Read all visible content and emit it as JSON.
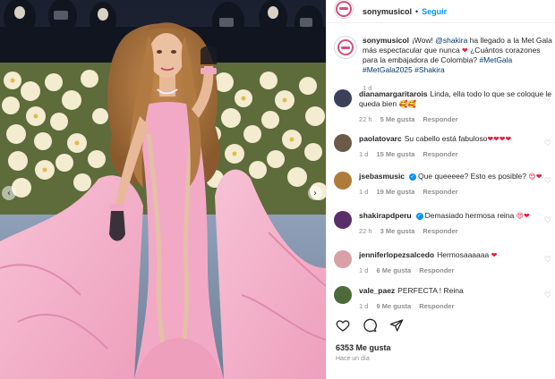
{
  "post": {
    "author": "sonymusicol",
    "follow_label": "Seguir",
    "caption": {
      "author": "sonymusicol",
      "text_before": "¡Wow! ",
      "mention": "@shakira",
      "text_line": " ha llegado a la Met Gala más espectacular que nunca ",
      "text_after": " ¿Cuántos corazones para la embajadora de Colombia? ",
      "hashtags": "#MetGala #MetGala2025 #Shakira",
      "time": "1 d"
    },
    "likes": "6353 Me gusta",
    "posted": "Hace un día"
  },
  "comments": [
    {
      "user": "dianamargaritarois",
      "text": "Linda, ella todo lo que se coloque le queda bien ",
      "emoji": "🥰🥰",
      "time": "22 h",
      "likes": "5 Me gusta",
      "reply": "Responder",
      "avatar_color": "#3a3f5a"
    },
    {
      "user": "paolatovarc",
      "text": "Su cabello está fabuloso",
      "emoji": "❤❤❤❤",
      "time": "1 d",
      "likes": "15 Me gusta",
      "reply": "Responder",
      "avatar_color": "#6b5a48"
    },
    {
      "user": "jsebasmusic",
      "text": "Que queeeee? Esto es posible? ",
      "emoji": "😍❤",
      "time": "1 d",
      "likes": "19 Me gusta",
      "reply": "Responder",
      "avatar_color": "#b07a3a"
    },
    {
      "user": "shakirapdperu",
      "text": "Demasiado hermosa reina ",
      "emoji": "😍❤",
      "time": "22 h",
      "likes": "3 Me gusta",
      "reply": "Responder",
      "avatar_color": "#5a2e6b"
    },
    {
      "user": "jenniferlopezsalcedo",
      "text": "Hermosaaaaaa ",
      "emoji": "❤",
      "time": "1 d",
      "likes": "6 Me gusta",
      "reply": "Responder",
      "avatar_color": "#d9a0a8"
    },
    {
      "user": "vale_paez",
      "text": "PERFECTA ! Reina",
      "emoji": "",
      "time": "1 d",
      "likes": "9 Me gusta",
      "reply": "Responder",
      "avatar_color": "#4c6a3a"
    }
  ],
  "colors": {
    "accent": "#0095f6",
    "heart": "#ed1c3b",
    "muted": "#8e8e8e",
    "dress": "#f2a9c6"
  },
  "icons": [
    "chevron-left-icon",
    "chevron-right-icon",
    "heart-icon",
    "comment-icon",
    "share-icon",
    "verified-icon"
  ]
}
